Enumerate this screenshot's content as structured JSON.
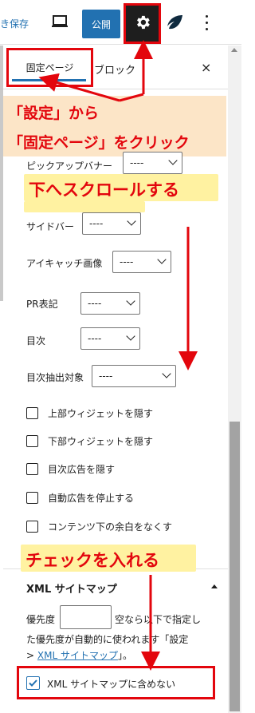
{
  "topbar": {
    "save_link": "き保存",
    "preview_icon": "laptop-icon",
    "publish_label": "公開",
    "settings_icon": "gear-icon",
    "plugin_icon": "leaf-icon",
    "more_icon": "more-vertical-icon"
  },
  "sidebar_tabs": {
    "page_tab": "固定ページ",
    "block_tab": "ブロック",
    "close_icon": "close-icon",
    "close_label": "×"
  },
  "annotations": {
    "settings_line1": "「設定」から",
    "settings_line2": "「固定ページ」をクリック",
    "scroll_down": "下へスクロールする",
    "check_it": "チェックを入れる",
    "accent_color": "#e3060d",
    "callout_orange": "#fce5c7",
    "callout_yellow": "#fff2a1"
  },
  "fields": {
    "pickup_banner": {
      "label": "ピックアップバナー",
      "value": "----"
    },
    "sidebar": {
      "label": "サイドバー",
      "value": "----"
    },
    "eyecatch": {
      "label": "アイキャッチ画像",
      "value": "----"
    },
    "pr_label": {
      "label": "PR表記",
      "value": "----"
    },
    "toc": {
      "label": "目次",
      "value": "----"
    },
    "toc_target": {
      "label": "目次抽出対象",
      "value": "----"
    }
  },
  "checkboxes": [
    {
      "label": "上部ウィジェットを隠す",
      "checked": false
    },
    {
      "label": "下部ウィジェットを隠す",
      "checked": false
    },
    {
      "label": "目次広告を隠す",
      "checked": false
    },
    {
      "label": "自動広告を停止する",
      "checked": false
    },
    {
      "label": "コンテンツ下の余白をなくす",
      "checked": false
    }
  ],
  "xml_sitemap": {
    "title": "XML サイトマップ",
    "priority_label": "優先度",
    "priority_value": "",
    "desc_line1": "空なら以下で指定し",
    "desc_line2": "た優先度が自動的に使われます「設定",
    "desc_line3_prefix": "> ",
    "desc_link": "XML サイトマップ",
    "desc_line3_suffix": "」。",
    "exclude_label": "XML サイトマップに含めない",
    "exclude_checked": true,
    "brand_color": "#2271b1"
  }
}
